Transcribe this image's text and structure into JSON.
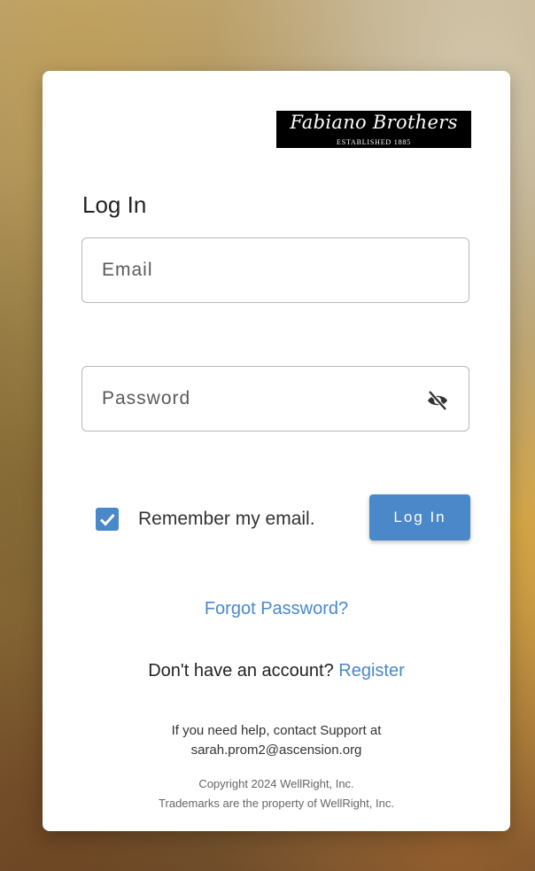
{
  "logo": {
    "name": "Fabiano Brothers",
    "tagline": "ESTABLISHED 1885"
  },
  "login": {
    "title": "Log In",
    "email_placeholder": "Email",
    "password_placeholder": "Password",
    "password_toggle_icon": "eye-off-icon",
    "remember_label": "Remember my email.",
    "remember_checked": true,
    "submit_label": "Log In"
  },
  "links": {
    "forgot_password": "Forgot Password?",
    "no_account_text": "Don't have an account?",
    "register": "Register"
  },
  "footer": {
    "help_line1": "If you need help, contact Support at",
    "help_email": "sarah.prom2@ascension.org",
    "copyright": "Copyright 2024 WellRight, Inc.",
    "trademarks": "Trademarks are the property of WellRight, Inc."
  },
  "colors": {
    "accent": "#4a88c9",
    "card": "#ffffff"
  }
}
